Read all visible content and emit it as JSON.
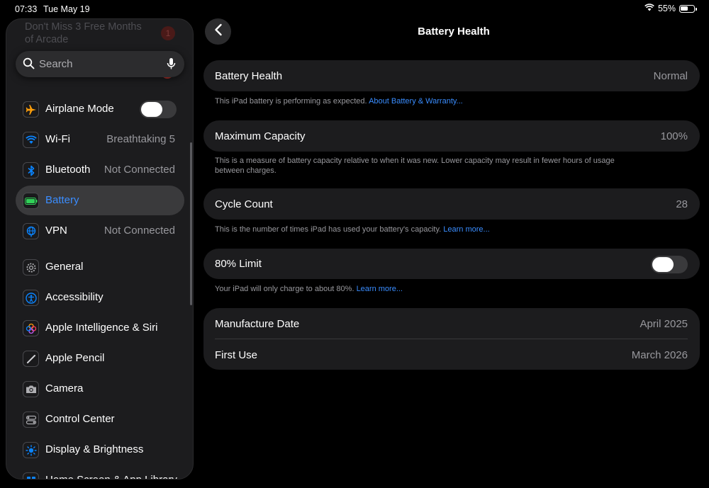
{
  "status_bar": {
    "time": "07:33",
    "date": "Tue May 19",
    "battery": "55%"
  },
  "sidebar": {
    "arcade_banner": "Don't Miss 3 Free Months of Arcade",
    "arcade_badge": "1",
    "search_placeholder": "Search",
    "items": [
      {
        "label": "Airplane Mode",
        "icon": "airplane-icon",
        "toggle": false
      },
      {
        "label": "Wi-Fi",
        "value": "Breathtaking 5",
        "icon": "wifi-icon"
      },
      {
        "label": "Bluetooth",
        "value": "Not Connected",
        "icon": "bluetooth-icon"
      },
      {
        "label": "Battery",
        "icon": "battery-icon",
        "selected": true
      },
      {
        "label": "VPN",
        "value": "Not Connected",
        "icon": "globe-icon"
      },
      {
        "label": "General",
        "icon": "gear-icon"
      },
      {
        "label": "Accessibility",
        "icon": "accessibility-icon"
      },
      {
        "label": "Apple Intelligence & Siri",
        "icon": "siri-icon"
      },
      {
        "label": "Apple Pencil",
        "icon": "pencil-icon"
      },
      {
        "label": "Camera",
        "icon": "camera-icon"
      },
      {
        "label": "Control Center",
        "icon": "control-center-icon"
      },
      {
        "label": "Display & Brightness",
        "icon": "sun-icon"
      },
      {
        "label": "Home Screen & App Library",
        "icon": "home-screen-icon"
      }
    ]
  },
  "main": {
    "title": "Battery Health",
    "battery_health": {
      "label": "Battery Health",
      "value": "Normal",
      "footer": "This iPad battery is performing as expected. ",
      "footer_link": "About Battery & Warranty..."
    },
    "max_capacity": {
      "label": "Maximum Capacity",
      "value": "100%",
      "footer": "This is a measure of battery capacity relative to when it was new. Lower capacity may result in fewer hours of usage between charges."
    },
    "cycle_count": {
      "label": "Cycle Count",
      "value": "28",
      "footer": "This is the number of times iPad has used your battery's capacity. ",
      "footer_link": "Learn more..."
    },
    "limit": {
      "label": "80% Limit",
      "toggle": false,
      "footer": "Your iPad will only charge to about 80%. ",
      "footer_link": "Learn more..."
    },
    "manufacture_date": {
      "label": "Manufacture Date",
      "value": "April 2025"
    },
    "first_use": {
      "label": "First Use",
      "value": "March 2026"
    }
  },
  "colors": {
    "accent": "#3a8dff",
    "background": "#000000",
    "card": "#1c1c1e",
    "secondary_text": "#98989d"
  }
}
